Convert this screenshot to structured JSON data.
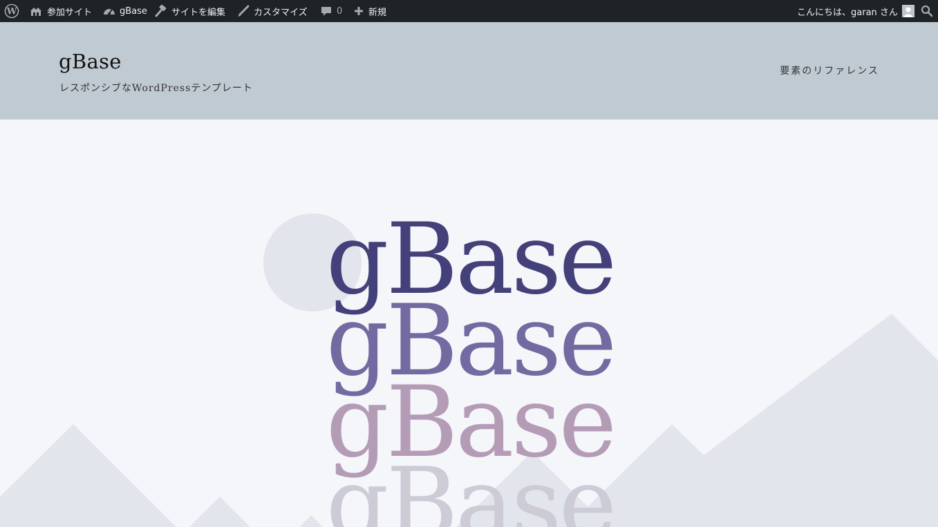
{
  "admin_bar": {
    "wp_logo_icon": "wordpress-icon",
    "my_sites": "参加サイト",
    "site_name": "gBase",
    "edit_site": "サイトを編集",
    "customize": "カスタマイズ",
    "comments_count": "0",
    "new": "新規",
    "greeting": "こんにちは、garan さん"
  },
  "header": {
    "site_title": "gBase",
    "tagline": "レスポンシブなWordPressテンプレート",
    "nav_item": "要素のリファレンス"
  },
  "hero": {
    "logo_words": [
      "gBase",
      "gBase",
      "gBase",
      "gBase"
    ],
    "colors": [
      "#43407a",
      "#726aa0",
      "#b59cb6",
      "#cccbd6"
    ],
    "background": "#f4f6fa",
    "shape_color": "#e2e5ec"
  }
}
